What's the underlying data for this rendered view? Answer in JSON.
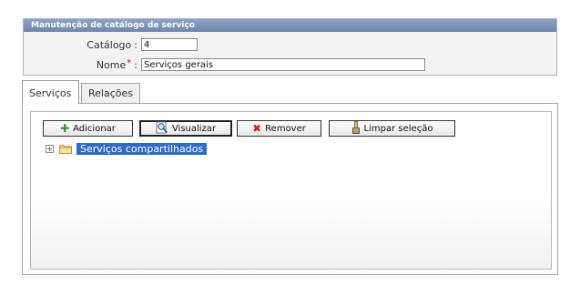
{
  "panel": {
    "title": "Manutenção de catálogo de serviço",
    "fields": {
      "catalogo": {
        "label": "Catálogo",
        "value": "4"
      },
      "nome": {
        "label": "Nome",
        "required_mark": "*",
        "value": "Serviços gerais"
      }
    },
    "colon": ":"
  },
  "tabs": [
    {
      "label": "Serviços",
      "active": true
    },
    {
      "label": "Relações",
      "active": false
    }
  ],
  "toolbar": {
    "add_label": "Adicionar",
    "view_label": "Visualizar",
    "remove_label": "Remover",
    "clear_label": "Limpar seleção"
  },
  "tree": {
    "root_label": "Serviços compartilhados",
    "expander": "+"
  },
  "colors": {
    "header": "#7a90b6",
    "selection": "#316ac5",
    "required": "#d00000"
  }
}
